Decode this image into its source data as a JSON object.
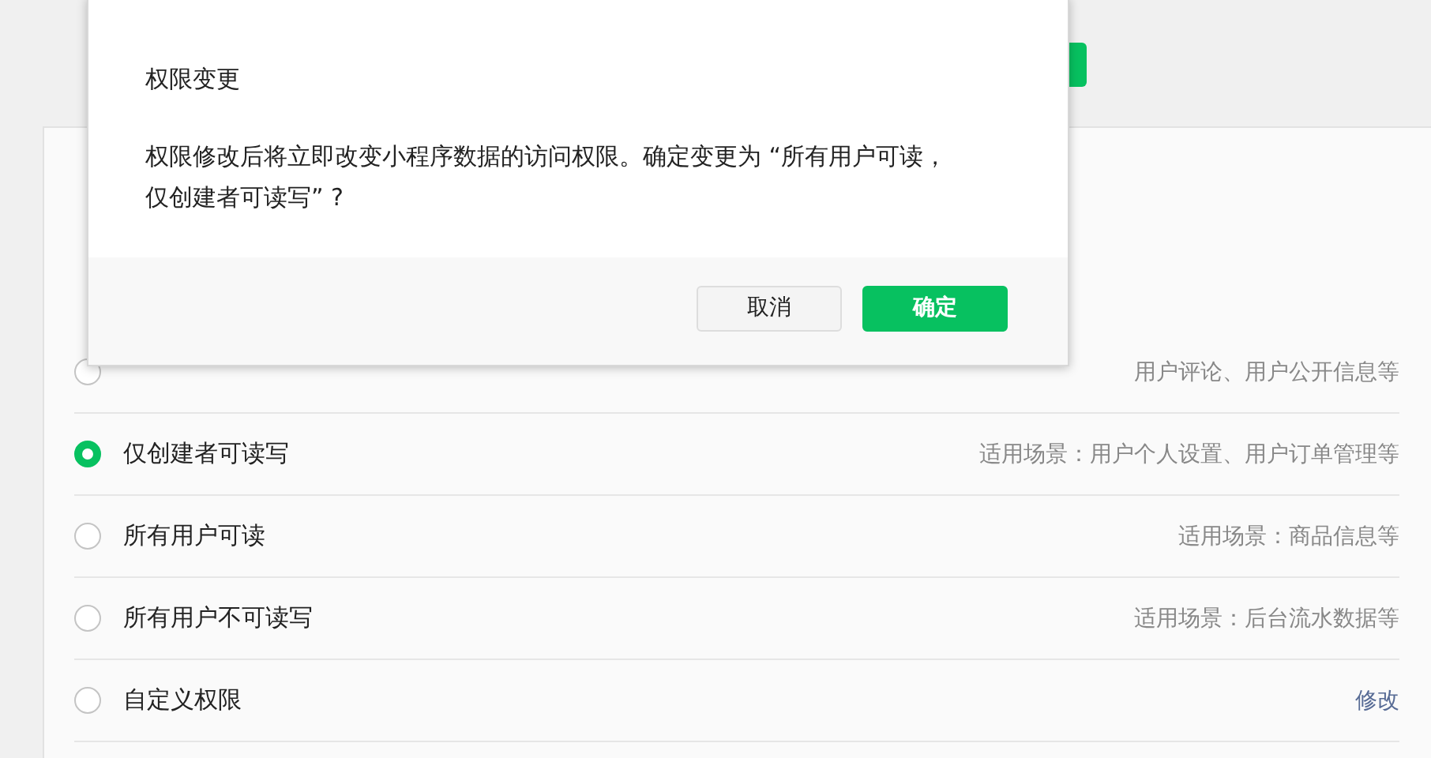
{
  "options": [
    {
      "description": "用户评论、用户公开信息等",
      "selected": false,
      "kind": "note"
    },
    {
      "label": "仅创建者可读写",
      "description": "适用场景：用户个人设置、用户订单管理等",
      "selected": true,
      "kind": "note"
    },
    {
      "label": "所有用户可读",
      "description": "适用场景：商品信息等",
      "selected": false,
      "kind": "note"
    },
    {
      "label": "所有用户不可读写",
      "description": "适用场景：后台流水数据等",
      "selected": false,
      "kind": "note"
    },
    {
      "label": "自定义权限",
      "description": "修改",
      "selected": false,
      "kind": "link"
    }
  ],
  "dialog": {
    "title": "权限变更",
    "message": "权限修改后将立即改变小程序数据的访问权限。确定变更为 “所有用户可读，仅创建者可读写” ?",
    "buttons": [
      {
        "label": "取消",
        "kind": "default"
      },
      {
        "label": "确定",
        "kind": "primary"
      }
    ]
  }
}
